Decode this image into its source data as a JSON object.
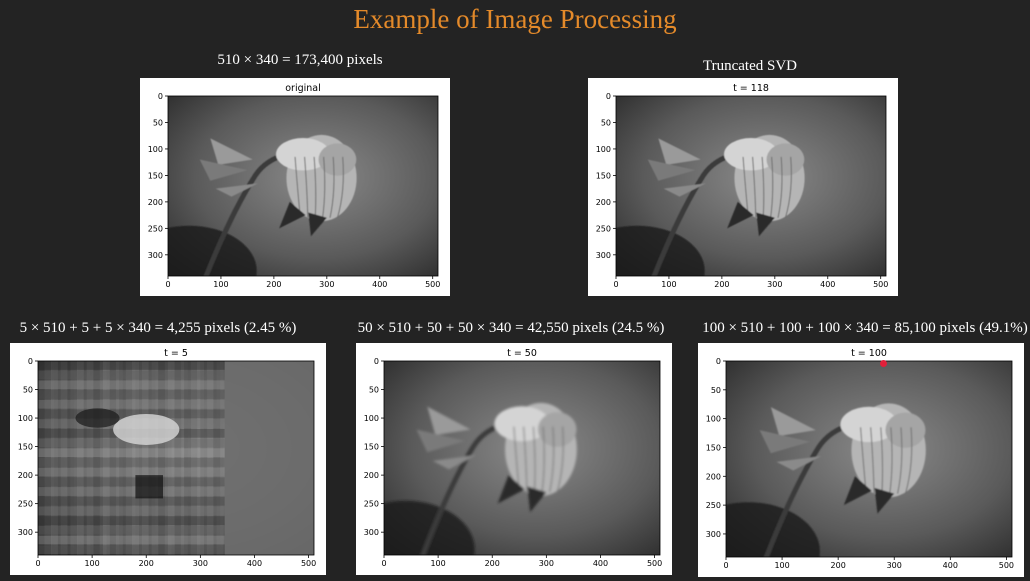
{
  "page": {
    "title": "Example of Image Processing"
  },
  "captions": {
    "original": "510 × 340 = 173,400 pixels",
    "svd": "Truncated SVD",
    "t5": "5 × 510 + 5 + 5 × 340 = 4,255 pixels (2.45 %)",
    "t50": "50 × 510 + 50 + 50 × 340 = 42,550 pixels (24.5 %)",
    "t100": "100 × 510 + 100 + 100 × 340 = 85,100 pixels (49.1%)"
  },
  "plots": [
    {
      "id": "original",
      "title": "original",
      "blur": 0,
      "noise": false
    },
    {
      "id": "t118",
      "title": "t = 118",
      "blur": 0,
      "noise": false
    },
    {
      "id": "t5",
      "title": "t = 5",
      "blur": 0,
      "noise": true
    },
    {
      "id": "t50",
      "title": "t = 50",
      "blur": 0.6,
      "noise": false
    },
    {
      "id": "t100",
      "title": "t = 100",
      "blur": 0.3,
      "noise": false
    }
  ],
  "axes": {
    "x_ticks": [
      "0",
      "100",
      "200",
      "300",
      "400",
      "500"
    ],
    "y_ticks": [
      "0",
      "50",
      "100",
      "150",
      "200",
      "250",
      "300"
    ],
    "x_range": [
      0,
      510
    ],
    "y_range": [
      0,
      340
    ]
  },
  "colors": {
    "title": "#e48a2a",
    "pointer": "#e0203a"
  }
}
